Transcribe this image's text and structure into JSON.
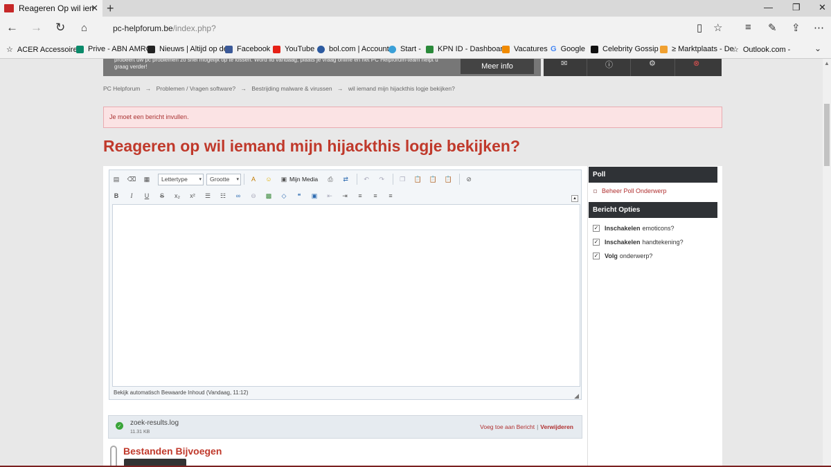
{
  "browser": {
    "tab_title": "Reageren Op wil iemand",
    "tab_close": "✕",
    "new_tab": "+",
    "address_host": "pc-helpforum.be",
    "address_path": "/index.php?",
    "favorites": [
      {
        "label": "ACER Accessoires",
        "color": "#666666"
      },
      {
        "label": "Prive - ABN AMRO",
        "color": "#0a8a6a"
      },
      {
        "label": "Nieuws | Altijd op de",
        "color": "#222222"
      },
      {
        "label": "Facebook",
        "color": "#3b5998"
      },
      {
        "label": "YouTube",
        "color": "#e62117"
      },
      {
        "label": "bol.com | Account",
        "color": "#2c5aa0"
      },
      {
        "label": "Start -",
        "color": "#3aa0d8"
      },
      {
        "label": "KPN ID - Dashboard",
        "color": "#2a8a3a"
      },
      {
        "label": "Vacatures",
        "color": "#f08a00"
      },
      {
        "label": "Google",
        "color": "#ffffff"
      },
      {
        "label": "Celebrity Gossip |",
        "color": "#111111"
      },
      {
        "label": "≥ Marktplaats - De",
        "color": "#f0a030"
      },
      {
        "label": "Outlook.com -",
        "color": "#666666"
      }
    ]
  },
  "banner": {
    "text": "probeert uw pc problemen zo snel mogelijk op te lossen. Word lid vandaag, plaats je vraag online en het PC Helpforum-team helpt u graag verder!",
    "button": "Meer info"
  },
  "breadcrumb": [
    "PC Helpforum",
    "→",
    "Problemen / Vragen software?",
    "→",
    "Bestrijding malware & virussen",
    "→",
    "wil iemand mijn hijackthis logje bekijken?"
  ],
  "error_message": "Je moet een bericht invullen.",
  "page_title": "Reageren op wil iemand mijn hijackthis logje bekijken?",
  "editor": {
    "font_select": "Lettertype",
    "size_select": "Grootte",
    "my_media": "Mijn Media",
    "autosave_text": "Bekijk automatisch Bewaarde Inhoud (Vandaag, 11:12)",
    "format_buttons": [
      "B",
      "I",
      "U",
      "S",
      "x₂",
      "x²"
    ]
  },
  "attachment": {
    "filename": "zoek-results.log",
    "size": "11.31 KB",
    "insert_link": "Voeg toe aan Bericht",
    "separator": "|",
    "delete_link": "Verwijderen"
  },
  "attach_heading": "Bestanden Bijvoegen",
  "sidebar": {
    "poll_title": "Poll",
    "poll_item": "Beheer Poll Onderwerp",
    "options_title": "Bericht Opties",
    "options": [
      {
        "bold": "Inschakelen",
        "rest": "emoticons?"
      },
      {
        "bold": "Inschakelen",
        "rest": "handtekening?"
      },
      {
        "bold": "Volg",
        "rest": "onderwerp?"
      }
    ]
  }
}
